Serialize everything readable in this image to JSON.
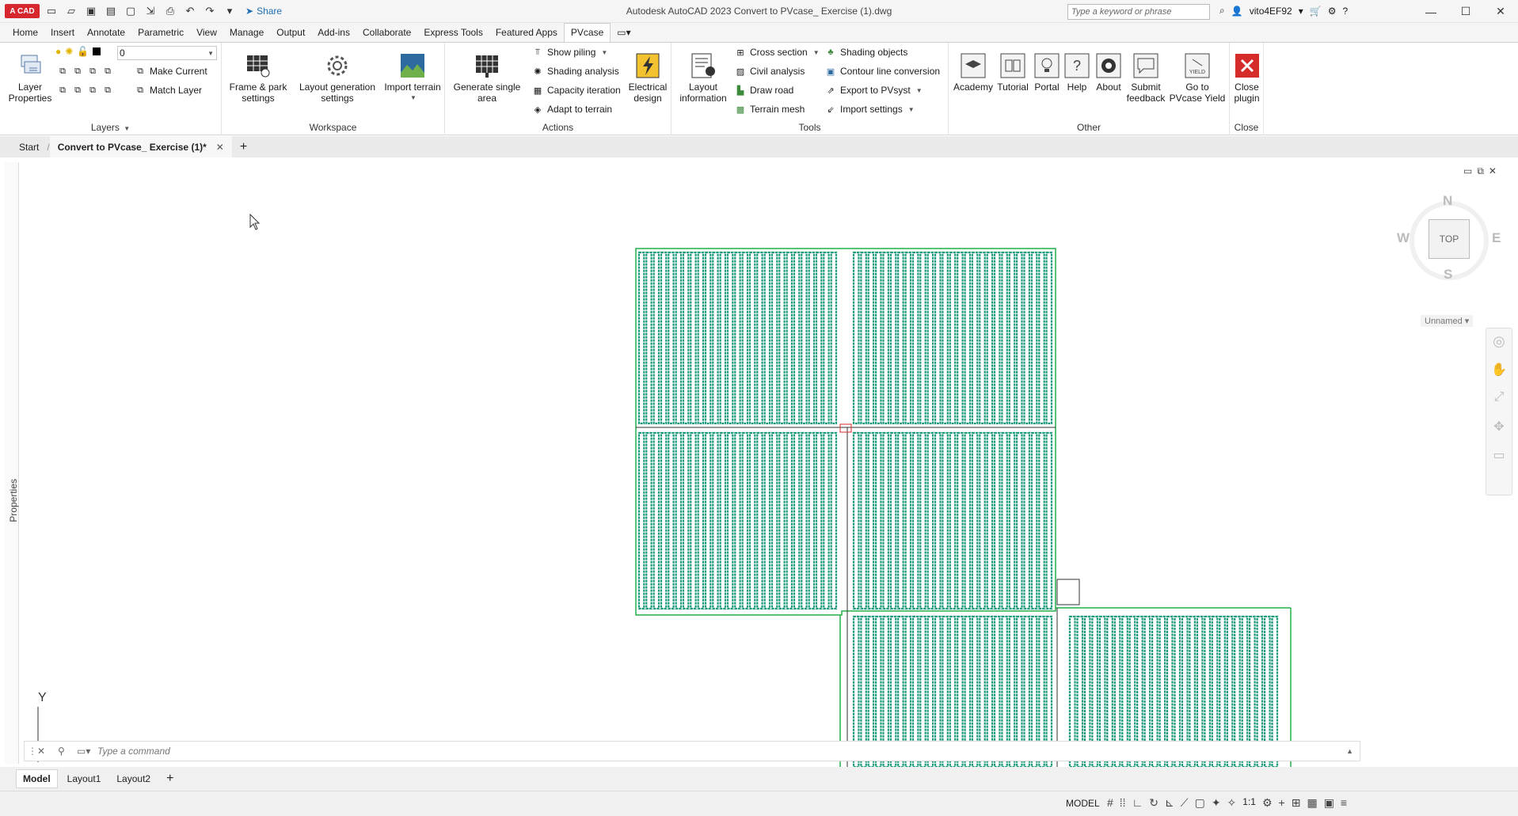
{
  "titlebar": {
    "app_logo": "A CAD",
    "share_label": "Share",
    "title": "Autodesk AutoCAD 2023    Convert to PVcase_ Exercise (1).dwg",
    "search_placeholder": "Type a keyword or phrase",
    "username": "vito4EF92"
  },
  "ribbon_tabs": [
    "Home",
    "Insert",
    "Annotate",
    "Parametric",
    "View",
    "Manage",
    "Output",
    "Add-ins",
    "Collaborate",
    "Express Tools",
    "Featured Apps",
    "PVcase"
  ],
  "active_tab": "PVcase",
  "ribbon": {
    "layers": {
      "title": "Layers",
      "layer_properties": "Layer\nProperties",
      "current_layer": "0",
      "make_current": "Make Current",
      "match_layer": "Match Layer"
    },
    "workspace": {
      "title": "Workspace",
      "frame_park": "Frame & park\nsettings",
      "layout_generation": "Layout generation\nsettings",
      "import_terrain": "Import terrain"
    },
    "actions": {
      "title": "Actions",
      "generate_single": "Generate single\narea",
      "show_piling": "Show piling",
      "shading_analysis": "Shading analysis",
      "capacity_iteration": "Capacity iteration",
      "adapt_terrain": "Adapt to terrain",
      "electrical_design": "Electrical\ndesign"
    },
    "tools": {
      "title": "Tools",
      "layout_information": "Layout\ninformation",
      "cross_section": "Cross section",
      "civil_analysis": "Civil analysis",
      "draw_road": "Draw road",
      "terrain_mesh": "Terrain mesh",
      "shading_objects": "Shading objects",
      "contour_line": "Contour line conversion",
      "export_pvsyst": "Export to PVsyst",
      "import_settings": "Import settings"
    },
    "other": {
      "title": "Other",
      "academy": "Academy",
      "tutorial": "Tutorial",
      "portal": "Portal",
      "help": "Help",
      "about": "About",
      "submit_feedback": "Submit\nfeedback",
      "go_yield": "Go to\nPVcase Yield"
    },
    "close": {
      "title": "Close",
      "close_plugin": "Close\nplugin"
    }
  },
  "file_tabs": {
    "start": "Start",
    "active": "Convert to PVcase_ Exercise (1)*"
  },
  "canvas": {
    "properties_label": "Properties",
    "viewcube": {
      "n": "N",
      "s": "S",
      "e": "E",
      "w": "W",
      "top": "TOP",
      "named_view": "Unnamed"
    },
    "ucs_label": "Y",
    "command_placeholder": "Type a command"
  },
  "layout_tabs": [
    "Model",
    "Layout1",
    "Layout2"
  ],
  "status": {
    "model": "MODEL",
    "scale": "1:1"
  },
  "colors": {
    "panel_green": "#1a9a7a",
    "boundary_green": "#22b04a",
    "accent_blue": "#1f6fb5",
    "close_red": "#d62b2b"
  }
}
